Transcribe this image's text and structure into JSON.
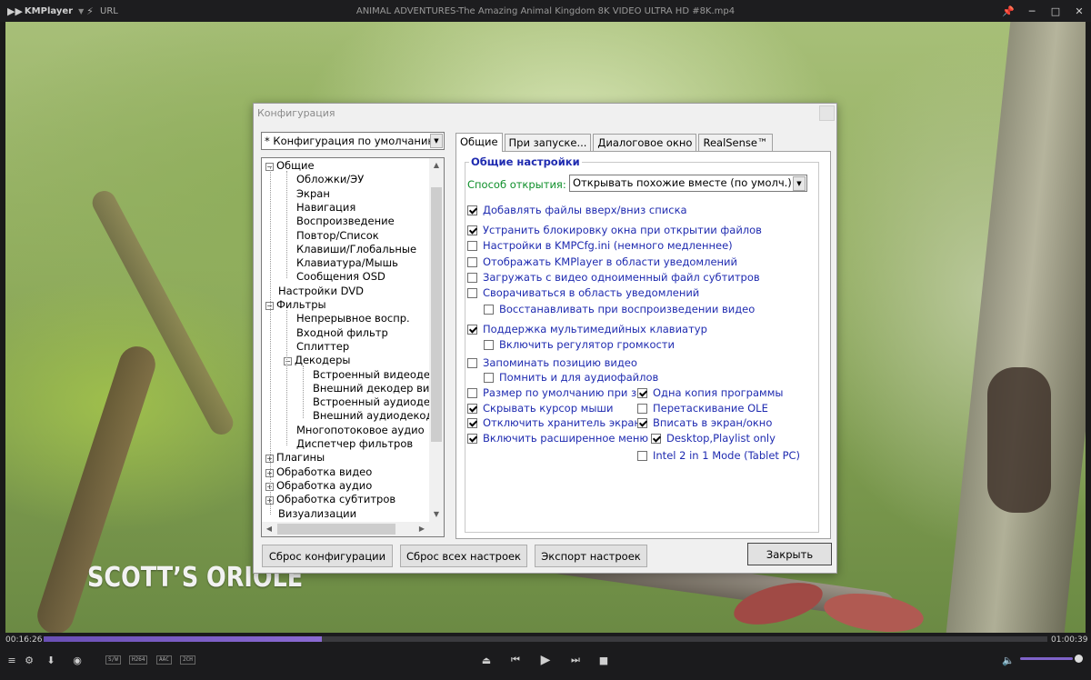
{
  "titlebar": {
    "app_name": "KMPlayer",
    "url_label": "URL",
    "file_title": "ANIMAL ADVENTURES-The Amazing Animal Kingdom 8K VIDEO ULTRA HD #8K.mp4"
  },
  "video": {
    "caption": "SCOTT’S ORIOLE"
  },
  "dialog": {
    "title": "Конфигурация",
    "config_select": "* Конфигурация по умолчанию",
    "tree": [
      {
        "label": "Общие",
        "level": 0,
        "expander": "−"
      },
      {
        "label": "Обложки/ЭУ",
        "level": 1
      },
      {
        "label": "Экран",
        "level": 1
      },
      {
        "label": "Навигация",
        "level": 1
      },
      {
        "label": "Воспроизведение",
        "level": 1
      },
      {
        "label": "Повтор/Список",
        "level": 1
      },
      {
        "label": "Клавиши/Глобальные",
        "level": 1
      },
      {
        "label": "Клавиатура/Мышь",
        "level": 1
      },
      {
        "label": "Сообщения OSD",
        "level": 1
      },
      {
        "label": "Настройки DVD",
        "level": 0
      },
      {
        "label": "Фильтры",
        "level": 0,
        "expander": "−"
      },
      {
        "label": "Непрерывное воспр.",
        "level": 1
      },
      {
        "label": "Входной фильтр",
        "level": 1
      },
      {
        "label": "Сплиттер",
        "level": 1
      },
      {
        "label": "Декодеры",
        "level": 1,
        "expander": "−"
      },
      {
        "label": "Встроенный видеодекодер",
        "level": 2
      },
      {
        "label": "Внешний декодер видео",
        "level": 2
      },
      {
        "label": "Встроенный аудиодекодер",
        "level": 2
      },
      {
        "label": "Внешний аудиодекодер",
        "level": 2
      },
      {
        "label": "Многопотоковое аудио",
        "level": 1
      },
      {
        "label": "Диспетчер фильтров",
        "level": 1
      },
      {
        "label": "Плагины",
        "level": 0,
        "expander": "+"
      },
      {
        "label": "Обработка видео",
        "level": 0,
        "expander": "+"
      },
      {
        "label": "Обработка аудио",
        "level": 0,
        "expander": "+"
      },
      {
        "label": "Обработка субтитров",
        "level": 0,
        "expander": "+"
      },
      {
        "label": "Визуализации",
        "level": 0
      }
    ],
    "tabs": [
      "Общие",
      "При запуске...",
      "Диалоговое окно",
      "RealSense™"
    ],
    "active_tab": "Общие",
    "group_title": "Общие настройки",
    "open_method_label": "Способ открытия:",
    "open_method_value": "Открывать похожие вместе (по умолч.)",
    "checkboxes": [
      {
        "label": "Добавлять файлы вверх/вниз списка",
        "checked": true
      },
      {
        "label": "Устранить блокировку окна при открытии файлов",
        "checked": true
      },
      {
        "label": "Настройки в KMPCfg.ini (немного медленнее)",
        "checked": false
      },
      {
        "label": "Отображать KMPlayer в области уведомлений",
        "checked": false
      },
      {
        "label": "Загружать с видео одноименный файл субтитров",
        "checked": false
      },
      {
        "label": "Сворачиваться в область уведомлений",
        "checked": false
      },
      {
        "label": "Восстанавливать при воспроизведении видео",
        "checked": false
      },
      {
        "label": "Поддержка мультимедийных клавиатур",
        "checked": true
      },
      {
        "label": "Включить регулятор громкости",
        "checked": false
      },
      {
        "label": "Запоминать позицию видео",
        "checked": false
      },
      {
        "label": "Помнить и для аудиофайлов",
        "checked": false
      },
      {
        "label": "Размер по умолчанию при запуске",
        "checked": false
      },
      {
        "label": "Скрывать курсор мыши",
        "checked": true
      },
      {
        "label": "Отключить хранитель экрана",
        "checked": true
      },
      {
        "label": "Включить расширенное меню",
        "checked": true
      },
      {
        "label": "Одна копия программы",
        "checked": true
      },
      {
        "label": "Перетаскивание OLE",
        "checked": false
      },
      {
        "label": "Вписать в экран/окно",
        "checked": true
      },
      {
        "label": "Desktop,Playlist only",
        "checked": true
      },
      {
        "label": "Intel 2 in 1 Mode (Tablet PC)",
        "checked": false
      }
    ],
    "buttons": {
      "reset_config": "Сброс конфигурации",
      "reset_all": "Сброс всех настроек",
      "export": "Экспорт настроек",
      "close": "Закрыть"
    }
  },
  "playback": {
    "current_time": "00:16:26",
    "total_time": "01:00:39",
    "progress": 0.277,
    "volume": 0.9,
    "badges": [
      "S/W",
      "H264",
      "AAC",
      "2CH"
    ]
  }
}
